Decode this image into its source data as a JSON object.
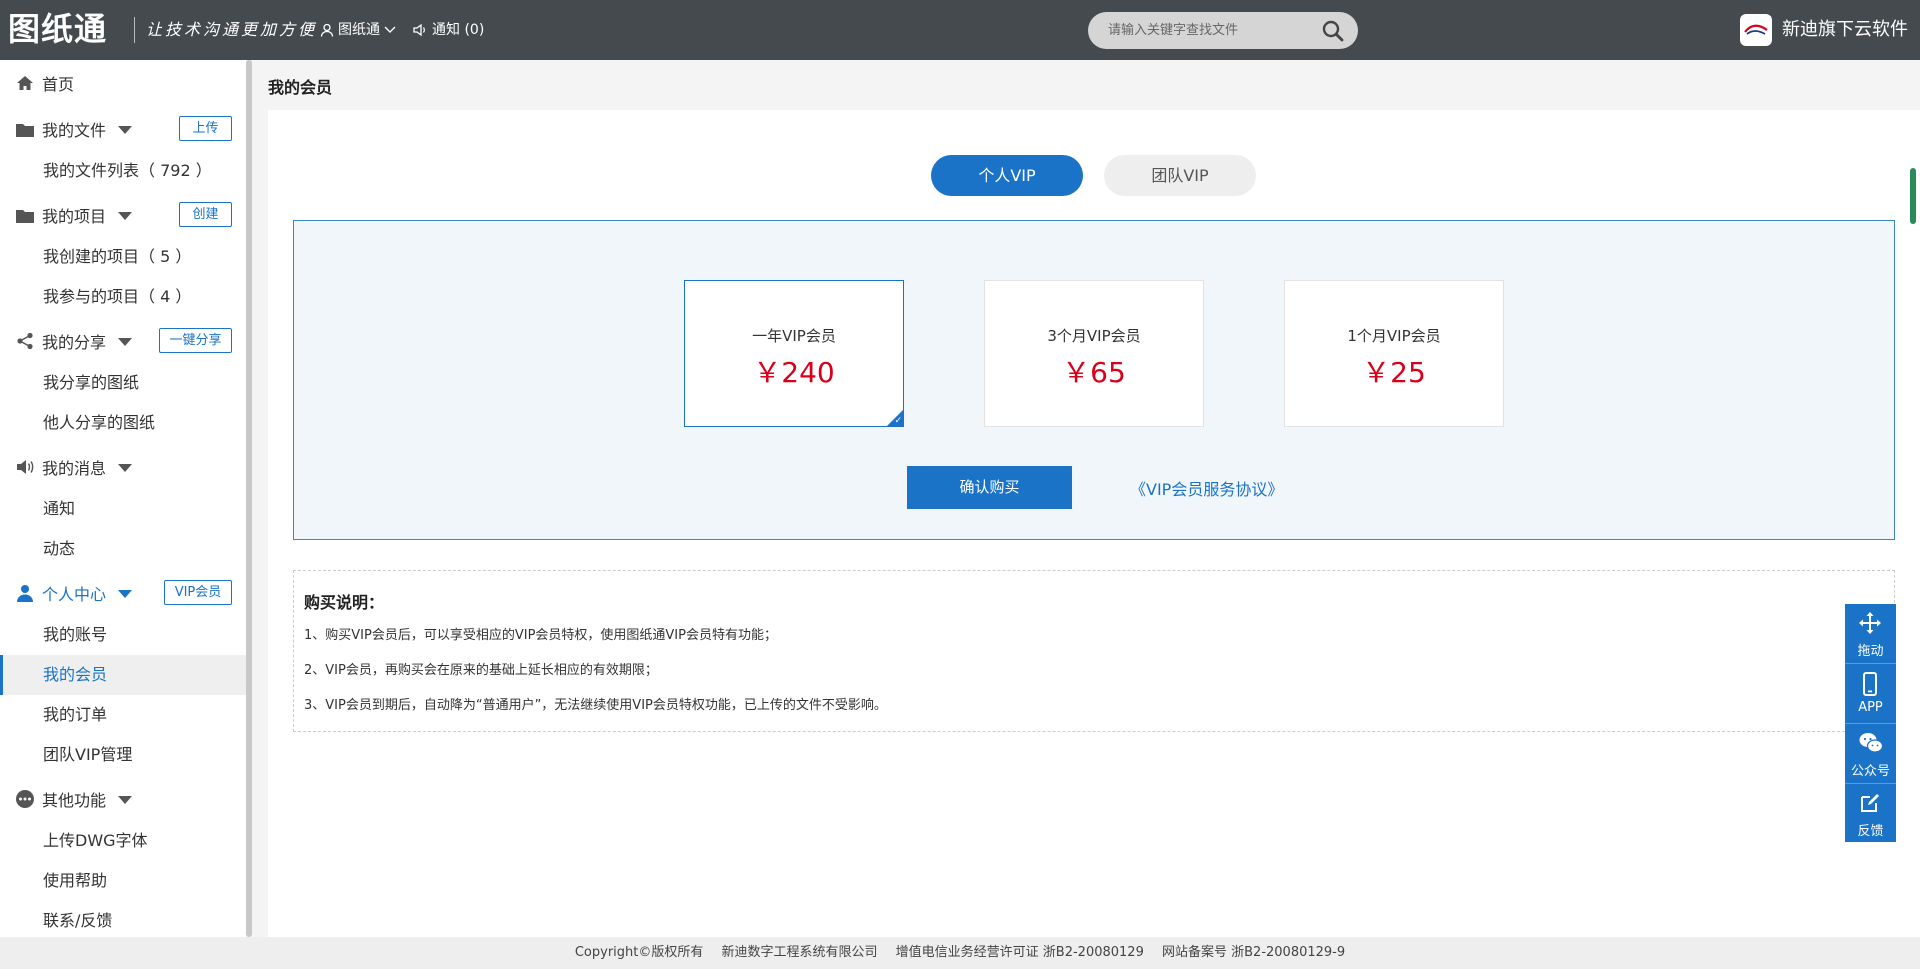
{
  "header": {
    "logo": "图纸通",
    "slogan": "让技术沟通更加方便",
    "user_label": "图纸通",
    "notice_label": "通知 (0)",
    "search_placeholder": "请输入关键字查找文件",
    "brand_label": "新迪旗下云软件"
  },
  "sidebar": {
    "home": "首页",
    "my_files": "我的文件",
    "upload_btn": "上传",
    "file_list": "我的文件列表（ 792 ）",
    "my_projects": "我的项目",
    "create_btn": "创建",
    "created_projects": "我创建的项目（ 5 ）",
    "joined_projects": "我参与的项目（ 4 ）",
    "my_share": "我的分享",
    "share_btn": "一键分享",
    "my_shared": "我分享的图纸",
    "others_shared": "他人分享的图纸",
    "my_messages": "我的消息",
    "notice": "通知",
    "activity": "动态",
    "personal_center": "个人中心",
    "vip_btn": "VIP会员",
    "my_account": "我的账号",
    "my_member": "我的会员",
    "my_orders": "我的订单",
    "team_vip": "团队VIP管理",
    "other_functions": "其他功能",
    "upload_font": "上传DWG字体",
    "help": "使用帮助",
    "contact": "联系/反馈"
  },
  "main": {
    "page_title": "我的会员",
    "tabs": [
      {
        "label": "个人VIP",
        "active": true
      },
      {
        "label": "团队VIP",
        "active": false
      }
    ],
    "plans": [
      {
        "name": "一年VIP会员",
        "price": "￥240",
        "selected": true
      },
      {
        "name": "3个月VIP会员",
        "price": "￥65",
        "selected": false
      },
      {
        "name": "1个月VIP会员",
        "price": "￥25",
        "selected": false
      }
    ],
    "confirm_label": "确认购买",
    "agreement_label": "《VIP会员服务协议》",
    "notes_title": "购买说明：",
    "notes": [
      "1、购买VIP会员后，可以享受相应的VIP会员特权，使用图纸通VIP会员特有功能；",
      "2、VIP会员，再购买会在原来的基础上延长相应的有效期限；",
      "3、VIP会员到期后，自动降为“普通用户”，无法继续使用VIP会员特权功能，已上传的文件不受影响。"
    ]
  },
  "float_tools": {
    "drag": "拖动",
    "app": "APP",
    "wechat": "公众号",
    "feedback": "反馈"
  },
  "footer": {
    "copyright": "Copyright©版权所有",
    "company": "新迪数字工程系统有限公司",
    "license": "增值电信业务经营许可证  浙B2-20080129",
    "record": "网站备案号  浙B2-20080129-9"
  },
  "colors": {
    "primary": "#1a73c7",
    "price": "#d9001b",
    "header_bg": "#444a4d"
  }
}
